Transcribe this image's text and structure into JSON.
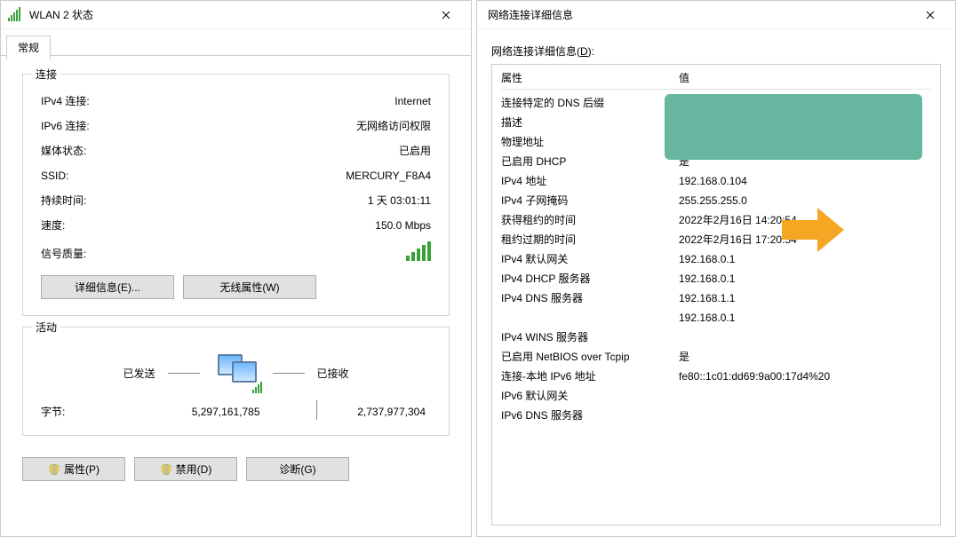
{
  "left": {
    "title": "WLAN 2 状态",
    "tab": "常规",
    "group_conn": {
      "title": "连接",
      "ipv4_label": "IPv4 连接:",
      "ipv4_value": "Internet",
      "ipv6_label": "IPv6 连接:",
      "ipv6_value": "无网络访问权限",
      "media_label": "媒体状态:",
      "media_value": "已启用",
      "ssid_label": "SSID:",
      "ssid_value": "MERCURY_F8A4",
      "duration_label": "持续时间:",
      "duration_value": "1 天 03:01:11",
      "speed_label": "速度:",
      "speed_value": "150.0 Mbps",
      "quality_label": "信号质量:",
      "btn_details": "详细信息(E)...",
      "btn_wireless": "无线属性(W)"
    },
    "group_activity": {
      "title": "活动",
      "sent_label": "已发送",
      "recv_label": "已接收",
      "bytes_label": "字节:",
      "bytes_sent": "5,297,161,785",
      "bytes_recv": "2,737,977,304"
    },
    "buttons": {
      "properties": "属性(P)",
      "disable": "禁用(D)",
      "diagnose": "诊断(G)"
    }
  },
  "right": {
    "title": "网络连接详细信息",
    "subheader_prefix": "网络连接详细信息(",
    "subheader_key": "D",
    "subheader_suffix": "):",
    "col_prop": "属性",
    "col_val": "值",
    "rows": {
      "dns_suffix": "连接特定的 DNS 后缀",
      "desc": "描述",
      "phys": "物理地址",
      "dhcp_enabled": "已启用 DHCP",
      "dhcp_enabled_v": "是",
      "ipv4_addr": "IPv4 地址",
      "ipv4_addr_v": "192.168.0.104",
      "subnet": "IPv4 子网掩码",
      "subnet_v": "255.255.255.0",
      "lease_obtained": "获得租约的时间",
      "lease_obtained_v": "2022年2月16日 14:20:54",
      "lease_expires": "租约过期的时间",
      "lease_expires_v": "2022年2月16日 17:20:54",
      "def_gw": "IPv4 默认网关",
      "def_gw_v": "192.168.0.1",
      "dhcp_srv": "IPv4 DHCP 服务器",
      "dhcp_srv_v": "192.168.0.1",
      "dns_srv": "IPv4 DNS 服务器",
      "dns_srv_v1": "192.168.1.1",
      "dns_srv_v2": "192.168.0.1",
      "wins": "IPv4 WINS 服务器",
      "netbios": "已启用 NetBIOS over Tcpip",
      "netbios_v": "是",
      "ll_ipv6": "连接-本地 IPv6 地址",
      "ll_ipv6_v": "fe80::1c01:dd69:9a00:17d4%20",
      "ipv6_gw": "IPv6 默认网关",
      "ipv6_dns": "IPv6 DNS 服务器"
    }
  }
}
